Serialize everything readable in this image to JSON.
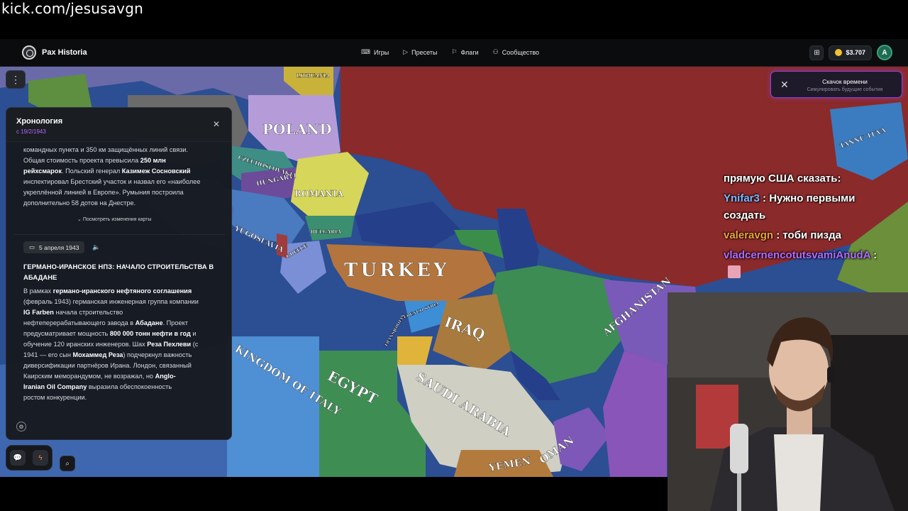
{
  "stream": {
    "url": "kick.com/jesusavgn"
  },
  "header": {
    "brand": "Pax Historia",
    "nav": [
      {
        "label": "Игры",
        "icon": "gamepad-icon"
      },
      {
        "label": "Пресеты",
        "icon": "play-icon"
      },
      {
        "label": "Флаги",
        "icon": "flag-icon"
      },
      {
        "label": "Сообщество",
        "icon": "users-icon"
      }
    ],
    "balance": "$3.707",
    "avatar_letter": "A"
  },
  "map": {
    "labels": [
      "POLAND",
      "ROMANIA",
      "HUNGARY",
      "YUGOSLAVIA",
      "BULGARIA",
      "GREECE",
      "CZECHOSLOVAKIA",
      "TURKEY",
      "IRAQ",
      "EGYPT",
      "SAUDI ARABIA",
      "AFGHANISTAN",
      "OMAN",
      "YEMEN",
      "TANNU TUVA",
      "KINGDOM OF ITALY",
      "FRENCH SYRIA",
      "TRANSJORDAN",
      "LITHUANIA"
    ]
  },
  "timeline": {
    "title": "Хронология",
    "date": "с 19/2/1943",
    "prev_entry": {
      "line1": "командных пункта и 350 км защищённых линий связи.",
      "line2_pre": "Общая стоимость проекта превысила ",
      "line2_bold": "250 млн",
      "line3_bold": "рейхсмарок",
      "line3_mid": ". Польский генерал ",
      "line3_bold2": "Казимеж Сосновский",
      "line4": "инспектировал Брестский участок и назвал его «наиболее",
      "line5": "укреплённой линией в Европе». Румыния построила",
      "line6": "дополнительно 58 дотов на Днестре."
    },
    "map_changes": "Посмотреть изменения карты",
    "event": {
      "date": "5 апреля 1943",
      "title": "ГЕРМАНО-ИРАНСКОЕ НПЗ: НАЧАЛО СТРОИТЕЛЬСТВА В АБАДАНЕ",
      "body": [
        [
          "В рамках ",
          "германо-иранского нефтяного соглашения"
        ],
        [
          "(февраль 1943) германская инженерная группа компании",
          ""
        ],
        [
          "",
          "IG Farben",
          " начала строительство"
        ],
        [
          "нефтеперерабатывающего завода в ",
          "Абадане",
          ". Проект"
        ],
        [
          "предусматривает мощность ",
          "800 000 тонн нефти в год",
          " и"
        ],
        [
          "обучение 120 иранских инженеров. Шах ",
          "Реза Пехлеви",
          " (с"
        ],
        [
          "1941 — его сын ",
          "Мохаммед Реза",
          ") подчеркнул важность"
        ],
        [
          "диверсификации партнёров Ирана. Лондон, связанный",
          ""
        ],
        [
          "Каирским меморандумом, не возражал, но ",
          "Anglo-"
        ],
        [
          "",
          "Iranian Oil Company",
          " выразила обеспокоенность"
        ],
        [
          "ростом конкуренции.",
          ""
        ]
      ]
    }
  },
  "time_jump": {
    "title": "Скачок времени",
    "subtitle": "Симулировать будущие события"
  },
  "chat": [
    {
      "user": "",
      "text": "прямую США сказать:",
      "color": "#ffffff"
    },
    {
      "user": "Ynifar3",
      "text": " : Нужно первыми",
      "color": "#7ab8ff"
    },
    {
      "user": "",
      "text": "создать",
      "color": "#ffffff"
    },
    {
      "user": "valeravgn",
      "text": " : тоби пизда",
      "color": "#f0a23a"
    },
    {
      "user": "vladcernencotutsvamiAnudA",
      "text": " :",
      "color": "#b06bff"
    }
  ],
  "colors": {
    "accent_purple": "#8a44d9",
    "timeline_date": "#b36bff",
    "coin": "#f2c230"
  }
}
